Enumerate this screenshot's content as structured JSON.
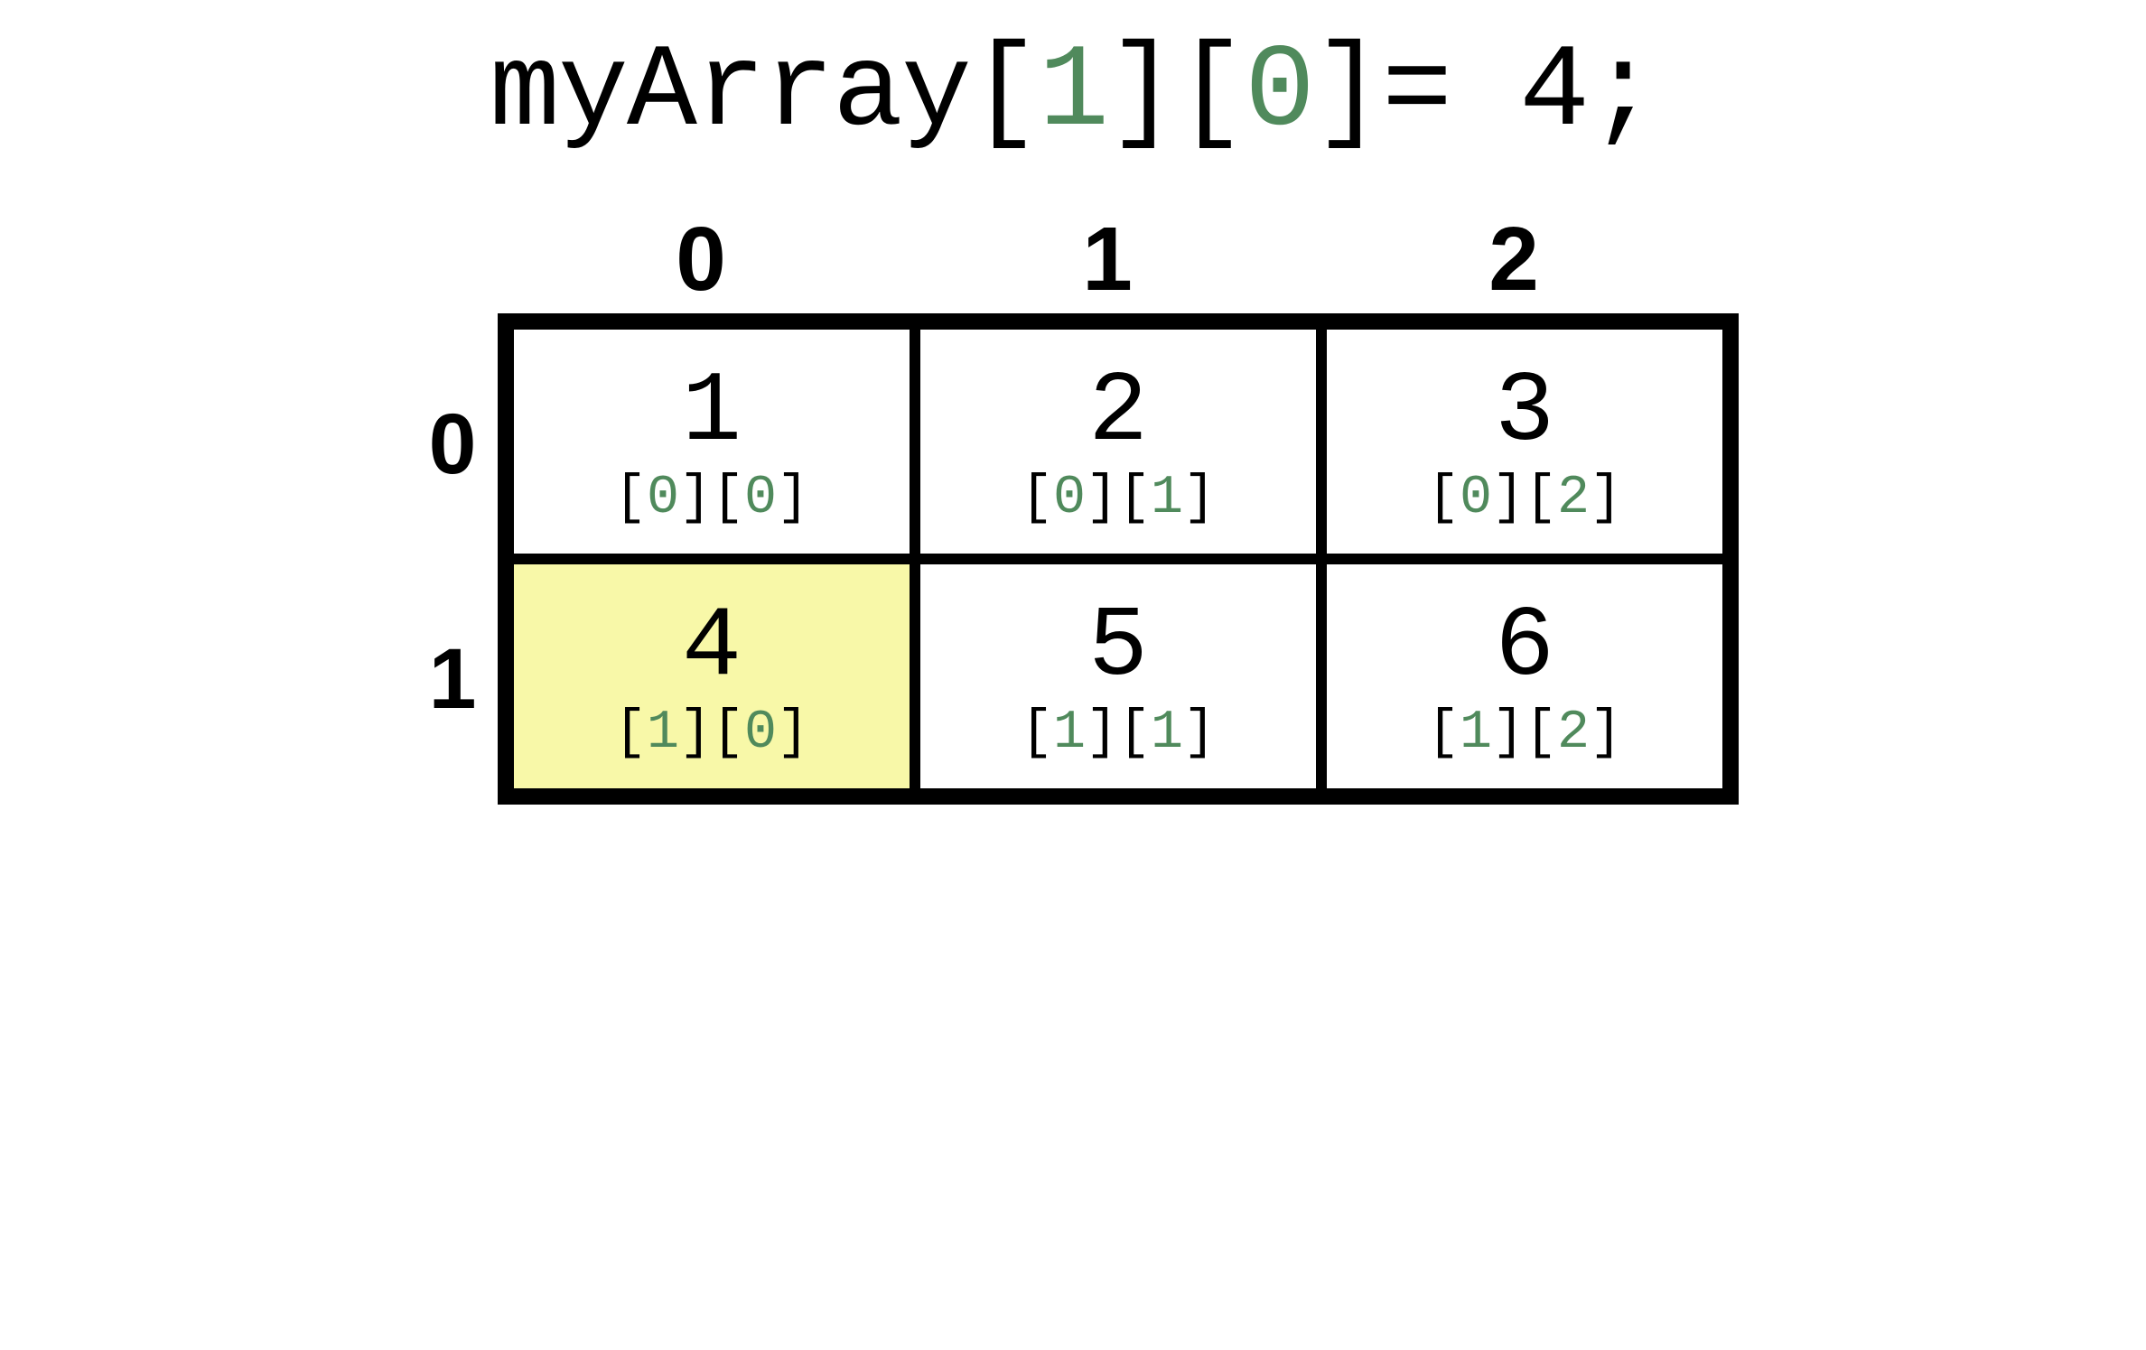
{
  "title": {
    "prefix": "myArray[",
    "idx0": "1",
    "mid1": "][",
    "idx1": "0",
    "mid2": "]= ",
    "value": "4",
    "suffix": ";"
  },
  "col_labels": [
    "0",
    "1",
    "2"
  ],
  "row_labels": [
    "0",
    "1"
  ],
  "cells": [
    {
      "value": "1",
      "i": "0",
      "j": "0",
      "highlight": false
    },
    {
      "value": "2",
      "i": "0",
      "j": "1",
      "highlight": false
    },
    {
      "value": "3",
      "i": "0",
      "j": "2",
      "highlight": false
    },
    {
      "value": "4",
      "i": "1",
      "j": "0",
      "highlight": true
    },
    {
      "value": "5",
      "i": "1",
      "j": "1",
      "highlight": false
    },
    {
      "value": "6",
      "i": "1",
      "j": "2",
      "highlight": false
    }
  ]
}
